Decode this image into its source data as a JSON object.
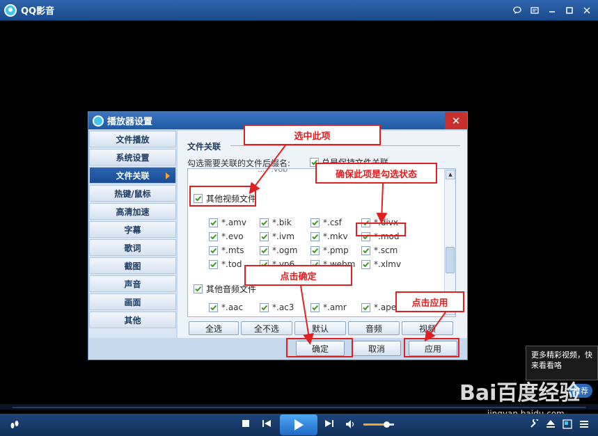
{
  "app": {
    "title": "QQ影音"
  },
  "dialog": {
    "title": "播放器设置",
    "close": "✕",
    "sidebar": [
      {
        "label": "文件播放",
        "active": false
      },
      {
        "label": "系统设置",
        "active": false
      },
      {
        "label": "文件关联",
        "active": true
      },
      {
        "label": "热键/鼠标",
        "active": false
      },
      {
        "label": "高清加速",
        "active": false
      },
      {
        "label": "字幕",
        "active": false
      },
      {
        "label": "歌词",
        "active": false
      },
      {
        "label": "截图",
        "active": false
      },
      {
        "label": "声音",
        "active": false
      },
      {
        "label": "画面",
        "active": false
      },
      {
        "label": "其他",
        "active": false
      }
    ],
    "section_title": "文件关联",
    "hint": "勾选需要关联的文件后缀名:",
    "always_keep": "总是保持文件关联",
    "partial_row": "... *.vob",
    "video_group": "其他视频文件",
    "video_exts": [
      [
        "*.amv",
        "*.bik",
        "*.csf",
        "*.divx"
      ],
      [
        "*.evo",
        "*.ivm",
        "*.mkv",
        "*.mod"
      ],
      [
        "*.mts",
        "*.ogm",
        "*.pmp",
        "*.scm"
      ],
      [
        "*.tod",
        "*.vp6",
        "*.webm",
        "*.xlmv"
      ]
    ],
    "audio_group": "其他音频文件",
    "audio_exts": [
      "*.aac",
      "*.ac3",
      "*.amr",
      "*.ape"
    ],
    "buttons": {
      "select_all": "全选",
      "select_none": "全不选",
      "default": "默认",
      "audio": "音频",
      "video": "视频"
    },
    "footer": {
      "ok": "确定",
      "cancel": "取消",
      "apply": "应用"
    }
  },
  "annotations": {
    "select_item": "选中此项",
    "ensure_checked": "确保此项是勾选状态",
    "click_ok": "点击确定",
    "click_apply": "点击应用"
  },
  "promo": {
    "text": "更多精彩视频，快来看看咯",
    "button": "推荐"
  },
  "watermark": {
    "brand": "Bai百度经验",
    "url": "jingyan.baidu.com"
  },
  "player": {
    "volume": 0.75
  },
  "colors": {
    "title_bar": "#1f5aa4",
    "active_item": "#1a4d94",
    "annotation": "#e02020",
    "check": "#3a9a1e"
  }
}
